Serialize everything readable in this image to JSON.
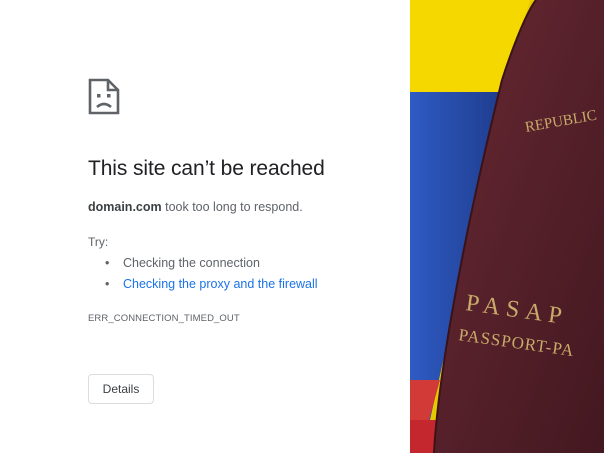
{
  "error_page": {
    "icon": "sad-page-icon",
    "title": "This site can’t be reached",
    "summary": {
      "domain": "domain.com",
      "message": " took too long to respond."
    },
    "try_label": "Try:",
    "suggestions": [
      {
        "label": "Checking the connection",
        "is_link": false
      },
      {
        "label": "Checking the proxy and the firewall",
        "is_link": true
      }
    ],
    "error_code": "ERR_CONNECTION_TIMED_OUT",
    "details_label": "Details",
    "colors": {
      "title": "#202124",
      "body_text": "#5f6368",
      "link": "#1a73e8",
      "button_border": "#dadce0"
    }
  },
  "photo": {
    "subject": "passport lying on a flag",
    "cover_text_top": "REPUBLIC",
    "cover_text_line1": "PASAP",
    "cover_text_line2": "PASSPORT-PA",
    "colors": {
      "flag_yellow": "#f2d500",
      "flag_blue": "#2a4fb0",
      "flag_red": "#c8242c",
      "passport_cover": "#5a1f26",
      "gold_text": "#c8aa6a"
    }
  }
}
